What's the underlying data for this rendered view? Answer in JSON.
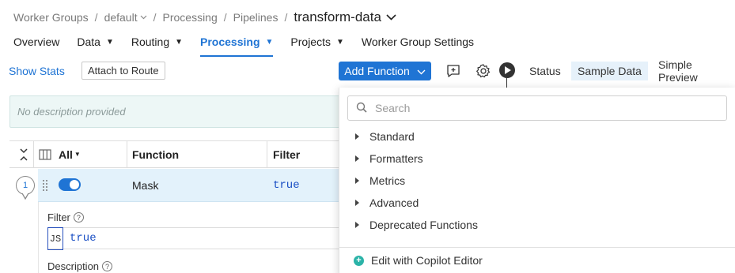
{
  "breadcrumb": {
    "items": [
      "Worker Groups",
      "default",
      "Processing",
      "Pipelines"
    ],
    "current": "transform-data"
  },
  "tabs": [
    {
      "label": "Overview",
      "caret": false
    },
    {
      "label": "Data",
      "caret": true
    },
    {
      "label": "Routing",
      "caret": true
    },
    {
      "label": "Processing",
      "caret": true,
      "active": true
    },
    {
      "label": "Projects",
      "caret": true
    },
    {
      "label": "Worker Group Settings",
      "caret": false
    }
  ],
  "toolbar": {
    "show_stats": "Show Stats",
    "attach_route": "Attach to Route",
    "add_function": "Add Function",
    "status": "Status",
    "sample_data": "Sample Data",
    "simple_preview": "Simple Preview"
  },
  "description": {
    "placeholder": "No description provided"
  },
  "table": {
    "all_label": "All",
    "columns": [
      "Function",
      "Filter"
    ],
    "rows": [
      {
        "number": "1",
        "function": "Mask",
        "filter": "true",
        "enabled": true
      }
    ]
  },
  "details": {
    "filter_label": "Filter",
    "filter_lang": "JS",
    "filter_value": "true",
    "description_label": "Description",
    "help_glyph": "?"
  },
  "dropdown": {
    "search_placeholder": "Search",
    "categories": [
      "Standard",
      "Formatters",
      "Metrics",
      "Advanced",
      "Deprecated Functions"
    ],
    "copilot_label": "Edit with Copilot Editor"
  },
  "colors": {
    "accent": "#1f74d4",
    "sample_data_bg": "#e6f1fa",
    "description_bg": "#edf7f6",
    "row_selected_bg": "#e3f2fb",
    "copilot": "#2bb3a8"
  }
}
